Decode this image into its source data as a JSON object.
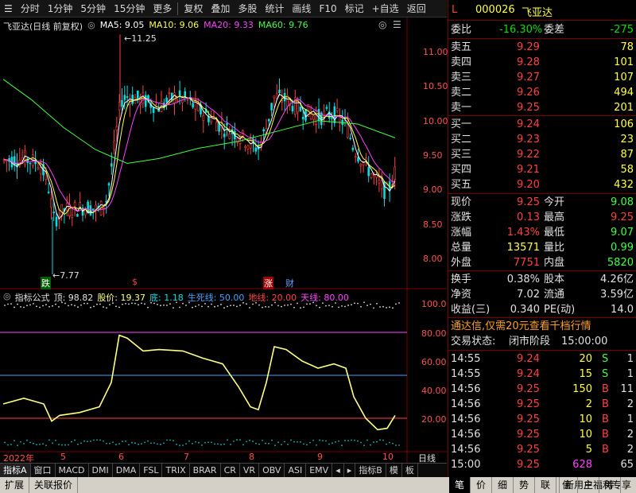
{
  "toolbar": {
    "items": [
      "分时",
      "1分钟",
      "5分钟",
      "15分钟",
      "更多",
      "复权",
      "叠加",
      "多股",
      "统计",
      "画线",
      "F10",
      "标记",
      "+自选",
      "返回"
    ]
  },
  "main_chart": {
    "legend": {
      "title": "飞亚达(日线 前复权)",
      "ma5": "MA5: 9.05",
      "ma10": "MA10: 9.06",
      "ma20": "MA20: 9.33",
      "ma60": "MA60: 9.76"
    },
    "high_marker": "11.25",
    "low_marker": "7.77",
    "y_ticks": [
      "11.00",
      "10.50",
      "10.00",
      "9.50",
      "9.00",
      "8.50",
      "8.00"
    ],
    "events": [
      "跌",
      "$",
      "涨",
      "财"
    ]
  },
  "indicator": {
    "legend": {
      "name": "指标公式",
      "top": "顶: 98.82",
      "price": "股价: 19.37",
      "bottom": "底: 1.18",
      "life": "生死线: 50.00",
      "ground": "地线: 20.00",
      "sky": "天线: 80.00"
    },
    "y_ticks": [
      "100.0",
      "80.00",
      "60.00",
      "40.00",
      "20.00"
    ]
  },
  "x_axis": {
    "labels": [
      "2022年",
      "5",
      "6",
      "7",
      "8",
      "9",
      "10"
    ],
    "cycle": "日线"
  },
  "bottom_tabs": [
    "指标A",
    "窗口",
    "MACD",
    "DMI",
    "DMA",
    "FSL",
    "TRIX",
    "BRAR",
    "CR",
    "VR",
    "OBV",
    "ASI",
    "EMV",
    "指标B",
    "模",
    "板"
  ],
  "bottom_bar": {
    "expand": "扩展",
    "related": "关联报价",
    "promo": "新用户福利专享"
  },
  "right_tabs": [
    "笔",
    "价",
    "细",
    "势",
    "联",
    "值",
    "主",
    "筹"
  ],
  "quote": {
    "code": "000026",
    "name": "飞亚达",
    "l_mark": "L",
    "weibi_label": "委比",
    "weibi": "-16.30%",
    "weicha_label": "委差",
    "weicha": "-275",
    "asks": [
      {
        "label": "卖五",
        "price": "9.29",
        "vol": "78"
      },
      {
        "label": "卖四",
        "price": "9.28",
        "vol": "101"
      },
      {
        "label": "卖三",
        "price": "9.27",
        "vol": "107"
      },
      {
        "label": "卖二",
        "price": "9.26",
        "vol": "494"
      },
      {
        "label": "卖一",
        "price": "9.25",
        "vol": "201"
      }
    ],
    "bids": [
      {
        "label": "买一",
        "price": "9.24",
        "vol": "106"
      },
      {
        "label": "买二",
        "price": "9.23",
        "vol": "23"
      },
      {
        "label": "买三",
        "price": "9.22",
        "vol": "87"
      },
      {
        "label": "买四",
        "price": "9.21",
        "vol": "58"
      },
      {
        "label": "买五",
        "price": "9.20",
        "vol": "432"
      }
    ],
    "stats": [
      {
        "l1": "现价",
        "v1": "9.25",
        "l2": "今开",
        "v2": "9.08"
      },
      {
        "l1": "涨跌",
        "v1": "0.13",
        "l2": "最高",
        "v2": "9.25"
      },
      {
        "l1": "涨幅",
        "v1": "1.43%",
        "l2": "最低",
        "v2": "9.07"
      },
      {
        "l1": "总量",
        "v1": "13571",
        "l2": "量比",
        "v2": "0.99"
      },
      {
        "l1": "外盘",
        "v1": "7751",
        "l2": "内盘",
        "v2": "5820"
      }
    ],
    "stats2": [
      {
        "l1": "换手",
        "v1": "0.38%",
        "l2": "股本",
        "v2": "4.26亿"
      },
      {
        "l1": "净资",
        "v1": "7.02",
        "l2": "流通",
        "v2": "3.59亿"
      },
      {
        "l1": "收益(三)",
        "v1": "0.340",
        "l2": "PE(动)",
        "v2": "14.0"
      }
    ],
    "ad": "通达信,仅需20元查看千档行情",
    "status_label": "交易状态:",
    "status": "闭市阶段",
    "status_time": "15:00:00",
    "ticks": [
      {
        "t": "14:55",
        "p": "9.24",
        "v": "20",
        "s": "S",
        "n": "1"
      },
      {
        "t": "14:55",
        "p": "9.24",
        "v": "15",
        "s": "S",
        "n": "1"
      },
      {
        "t": "14:56",
        "p": "9.25",
        "v": "150",
        "s": "B",
        "n": "11"
      },
      {
        "t": "14:56",
        "p": "9.25",
        "v": "2",
        "s": "B",
        "n": "2"
      },
      {
        "t": "14:56",
        "p": "9.25",
        "v": "10",
        "s": "B",
        "n": "1"
      },
      {
        "t": "14:56",
        "p": "9.25",
        "v": "10",
        "s": "B",
        "n": "2"
      },
      {
        "t": "14:56",
        "p": "9.25",
        "v": "5",
        "s": "B",
        "n": "2"
      },
      {
        "t": "15:00",
        "p": "9.25",
        "v": "628",
        "s": "",
        "n": "65"
      }
    ]
  },
  "colors": {
    "up": "#ff4040",
    "down": "#00e0e0",
    "ma5": "#ffffff",
    "ma10": "#ffff40",
    "ma20": "#ff40ff",
    "ma60": "#40ff40",
    "grid": "#7a0000",
    "curve": "#ffff80"
  }
}
